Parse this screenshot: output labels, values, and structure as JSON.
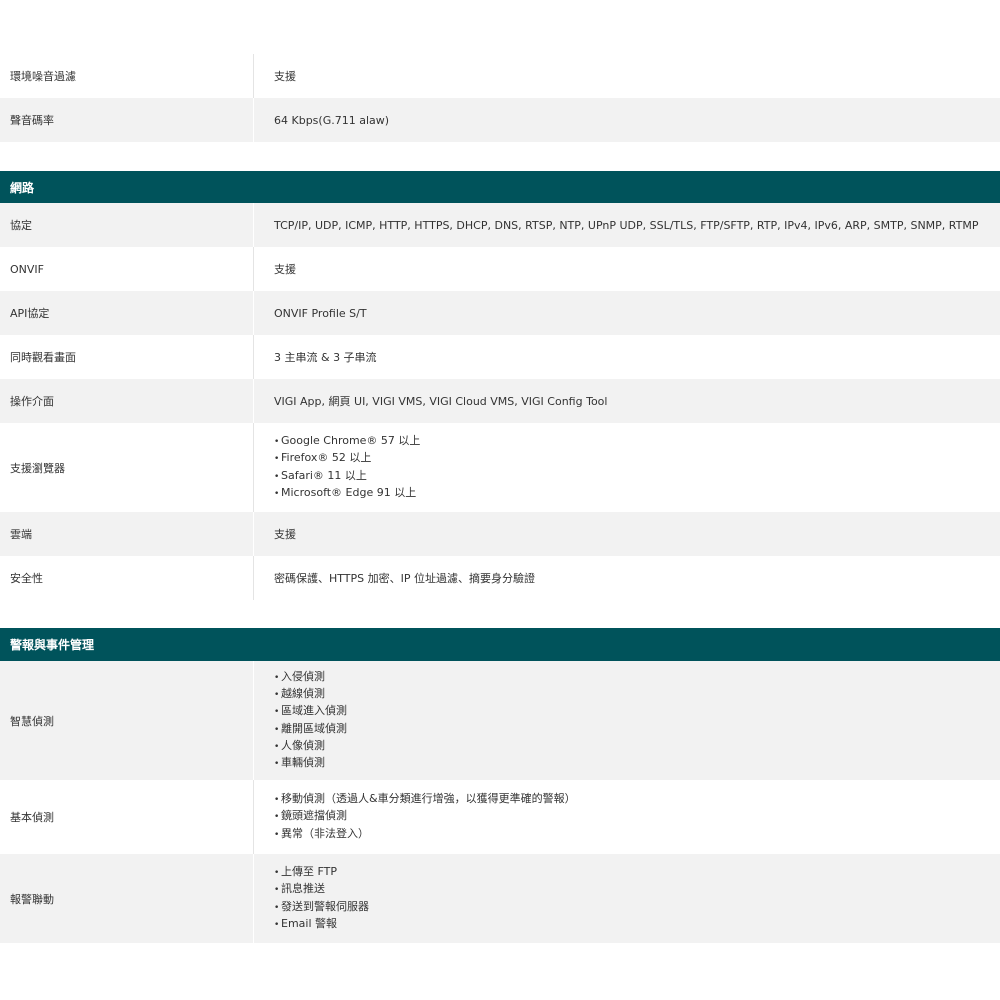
{
  "audio": {
    "rows": [
      {
        "label": "環境噪音過濾",
        "value": "支援"
      },
      {
        "label": "聲音碼率",
        "value": "64 Kbps(G.711 alaw)"
      }
    ]
  },
  "network": {
    "title": "網路",
    "protocol": {
      "label": "協定",
      "value": "TCP/IP, UDP, ICMP, HTTP, HTTPS, DHCP, DNS, RTSP, NTP, UPnP UDP, SSL/TLS, FTP/SFTP, RTP, IPv4, IPv6, ARP, SMTP, SNMP, RTMP"
    },
    "onvif": {
      "label": "ONVIF",
      "value": "支援"
    },
    "api": {
      "label": "API協定",
      "value": "ONVIF Profile S/T"
    },
    "simultaneous": {
      "label": "同時觀看畫面",
      "value": "3 主串流 & 3 子串流"
    },
    "interface": {
      "label": "操作介面",
      "value": "VIGI App, 網頁 UI, VIGI VMS, VIGI Cloud VMS, VIGI Config Tool"
    },
    "browsers": {
      "label": "支援瀏覽器",
      "items": [
        "Google Chrome® 57 以上",
        "Firefox® 52 以上",
        "Safari® 11 以上",
        "Microsoft® Edge 91 以上"
      ]
    },
    "cloud": {
      "label": "雲端",
      "value": "支援"
    },
    "security": {
      "label": "安全性",
      "value": "密碼保護、HTTPS 加密、IP 位址過濾、摘要身分驗證"
    }
  },
  "alarm": {
    "title": "警報與事件管理",
    "smart": {
      "label": "智慧偵測",
      "items": [
        "入侵偵測",
        "越線偵測",
        "區域進入偵測",
        "離開區域偵測",
        "人像偵測",
        "車輛偵測"
      ]
    },
    "basic": {
      "label": "基本偵測",
      "items": [
        "移動偵測（透過人&車分類進行增強，以獲得更準確的警報）",
        "鏡頭遮擋偵測",
        "異常（非法登入）"
      ]
    },
    "linkage": {
      "label": "報警聯動",
      "items": [
        "上傳至 FTP",
        "訊息推送",
        "發送到警報伺服器",
        "Email 警報"
      ]
    }
  }
}
